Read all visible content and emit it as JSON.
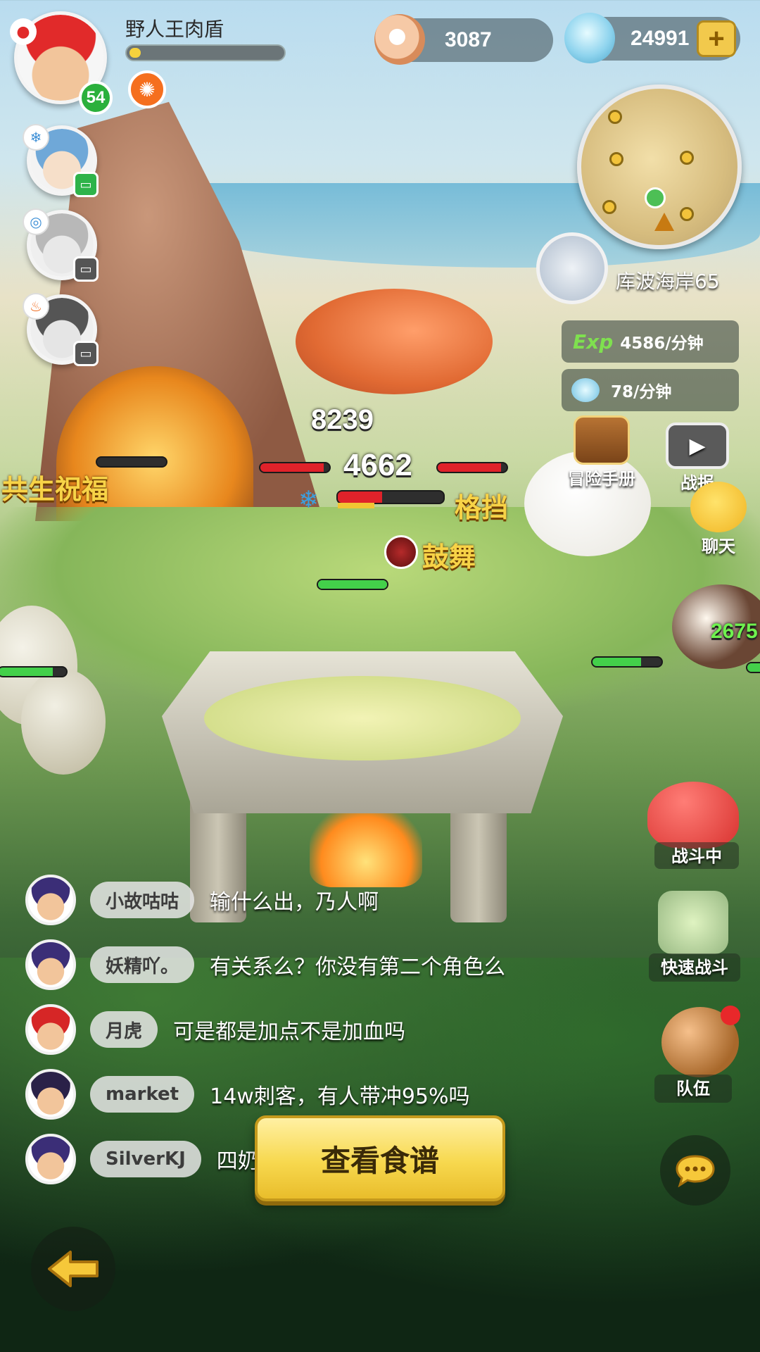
{
  "player": {
    "name": "野人王肉盾",
    "level": "54",
    "xp_fraction": 0.05
  },
  "currency": {
    "pearls": "3087",
    "shells": "24991"
  },
  "map": {
    "area_name": "库波海岸65"
  },
  "rates": {
    "exp_prefix": "Exp",
    "exp_rate": "4586/分钟",
    "shell_rate": "78/分钟"
  },
  "side_buttons": {
    "handbook": "冒险手册",
    "report": "战报",
    "chat": "聊天",
    "battling": "战斗中",
    "quick_battle": "快速战斗",
    "team": "队伍"
  },
  "battle": {
    "damage_top": "8239",
    "damage_main": "4662",
    "damage_side": "2675",
    "symbiosis_blessing": "共生祝福",
    "block": "格挡",
    "drum_dance": "鼓舞"
  },
  "chat": [
    {
      "name": "小故咕咕",
      "message": "输什么出，乃人啊"
    },
    {
      "name": "妖精吖。",
      "message": "有关系么？你没有第二个角色么"
    },
    {
      "name": "月虎",
      "message": "可是都是加点不是加血吗"
    },
    {
      "name": "market",
      "message": "14w刺客，有人带冲95%吗"
    },
    {
      "name": "SilverKJ",
      "message": "四奶"
    }
  ],
  "recipe_button": "查看食谱",
  "icons": {
    "back": "back-arrow-icon",
    "chat_bubble": "chat-bubble-icon",
    "plus": "plus-icon"
  },
  "colors": {
    "accent_gold": "#f7d347",
    "level_green": "#2bb03c",
    "hp_red": "#e0222a",
    "hp_green": "#43d04a"
  }
}
